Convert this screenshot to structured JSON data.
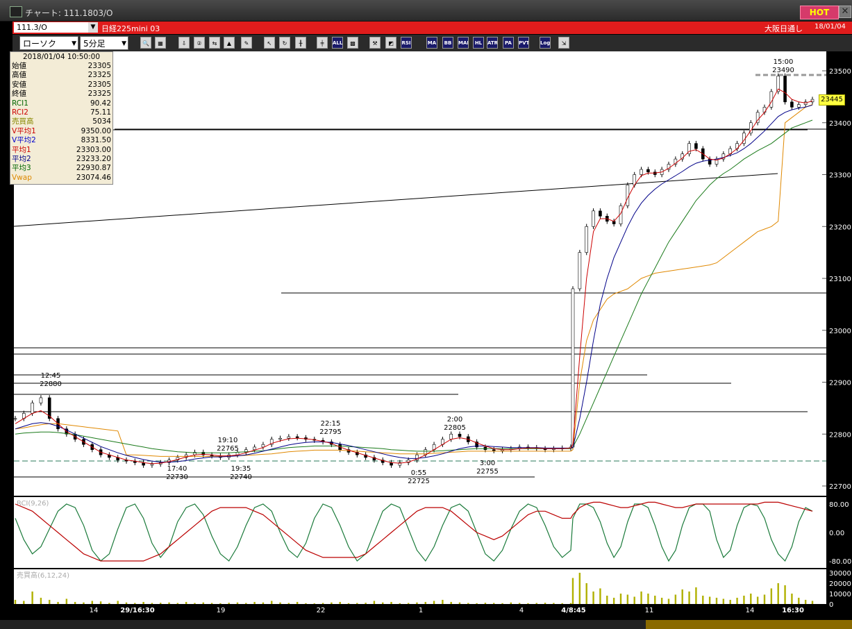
{
  "window": {
    "title": "チャート: 111.1803/O",
    "hot_label": "HOT",
    "close_label": "✕"
  },
  "header": {
    "code": "111.3/O",
    "code_dropdown": "▼",
    "instrument": "日経225mini 03",
    "session": "大阪日通し",
    "date": "18/01/04"
  },
  "toolbar": {
    "chart_type": "ローソク",
    "interval": "5分足",
    "dropdown_arrow": "▼",
    "buttons": [
      {
        "name": "zoom-icon",
        "label": "🔍"
      },
      {
        "name": "grid-icon",
        "label": "▦"
      },
      {
        "name": "draw-down-icon",
        "label": "⇩"
      },
      {
        "name": "count-icon",
        "label": "②"
      },
      {
        "name": "arrows-icon",
        "label": "⇆"
      },
      {
        "name": "fade-icon",
        "label": "▲"
      },
      {
        "name": "pen-icon",
        "label": "✎"
      },
      {
        "name": "cursor-icon",
        "label": "↖"
      },
      {
        "name": "rotate-icon",
        "label": "↻"
      },
      {
        "name": "candle-icon",
        "label": "╫"
      },
      {
        "name": "candle2-icon",
        "label": "╪"
      },
      {
        "name": "all-icon",
        "label": "ALL"
      },
      {
        "name": "pattern-icon",
        "label": "▩"
      },
      {
        "name": "tool-icon",
        "label": "⚒"
      },
      {
        "name": "color-icon",
        "label": "◩"
      },
      {
        "name": "rsi-icon",
        "label": "RSI"
      },
      {
        "name": "ma-icon",
        "label": "MA"
      },
      {
        "name": "bb-icon",
        "label": "BB"
      },
      {
        "name": "mae-icon",
        "label": "MAE"
      },
      {
        "name": "hl-icon",
        "label": "HL"
      },
      {
        "name": "atr-icon",
        "label": "ATR"
      },
      {
        "name": "para-icon",
        "label": "PA"
      },
      {
        "name": "pvt-icon",
        "label": "PVT"
      },
      {
        "name": "log-icon",
        "label": "Log"
      },
      {
        "name": "export-icon",
        "label": "⇲"
      }
    ]
  },
  "info_panel": {
    "datetime": "2018/01/04  10:50:00",
    "rows": [
      {
        "label": "始値",
        "value": "23305",
        "color": "#000000"
      },
      {
        "label": "高値",
        "value": "23325",
        "color": "#000000"
      },
      {
        "label": "安値",
        "value": "23305",
        "color": "#000000"
      },
      {
        "label": "終値",
        "value": "23325",
        "color": "#000000"
      },
      {
        "label": "RCI1",
        "value": "90.42",
        "color": "#006600"
      },
      {
        "label": "RCI2",
        "value": "75.11",
        "color": "#cc0000"
      },
      {
        "label": "売買高",
        "value": "5034",
        "color": "#888800"
      },
      {
        "label": "V平均1",
        "value": "9350.00",
        "color": "#cc0000"
      },
      {
        "label": "V平均2",
        "value": "8331.50",
        "color": "#0000cc"
      },
      {
        "label": "平均1",
        "value": "23303.00",
        "color": "#cc0000"
      },
      {
        "label": "平均2",
        "value": "23233.20",
        "color": "#000088"
      },
      {
        "label": "平均3",
        "value": "22930.87",
        "color": "#006600"
      },
      {
        "label": "Vwap",
        "value": "23074.46",
        "color": "#dd8800"
      }
    ]
  },
  "chart_data": {
    "type": "line",
    "price_axis": [
      23500,
      23400,
      23300,
      23200,
      23100,
      23000,
      22900,
      22800,
      22700
    ],
    "current_price": "23445",
    "annotations": [
      {
        "time": "12:45",
        "price": "22880"
      },
      {
        "time": "17:40",
        "price": "22730"
      },
      {
        "time": "19:10",
        "price": "22765"
      },
      {
        "time": "19:35",
        "price": "22740"
      },
      {
        "time": "22:15",
        "price": "22795"
      },
      {
        "time": "0:55",
        "price": "22725"
      },
      {
        "time": "2:00",
        "price": "22805"
      },
      {
        "time": "3:00",
        "price": "22755"
      },
      {
        "time": "15:00",
        "price": "23490"
      }
    ],
    "x_labels": [
      "14",
      "29/16:30",
      "19",
      "22",
      "1",
      "4",
      "4/8:45",
      "11",
      "14",
      "16:30"
    ],
    "rci_label": "RCI(9,26)",
    "rci_axis": [
      "80.00",
      "0.00",
      "-80.00"
    ],
    "volume_label": "売買高(6,12,24)",
    "volume_axis": [
      "30000",
      "20000",
      "10000",
      "0"
    ],
    "close": [
      22830,
      22840,
      22860,
      22870,
      22830,
      22810,
      22800,
      22790,
      22780,
      22770,
      22760,
      22755,
      22750,
      22748,
      22745,
      22740,
      22742,
      22745,
      22750,
      22755,
      22760,
      22765,
      22760,
      22758,
      22755,
      22760,
      22765,
      22770,
      22775,
      22780,
      22790,
      22792,
      22795,
      22793,
      22790,
      22788,
      22785,
      22780,
      22770,
      22765,
      22760,
      22755,
      22750,
      22745,
      22740,
      22745,
      22750,
      22760,
      22770,
      22780,
      22790,
      22800,
      22795,
      22785,
      22775,
      22770,
      22768,
      22770,
      22772,
      22775,
      22774,
      22772,
      22770,
      22772,
      22773,
      22775,
      23080,
      23150,
      23200,
      23230,
      23220,
      23210,
      23205,
      23240,
      23280,
      23300,
      23310,
      23305,
      23300,
      23310,
      23320,
      23330,
      23340,
      23360,
      23350,
      23330,
      23320,
      23330,
      23340,
      23350,
      23360,
      23380,
      23400,
      23420,
      23430,
      23460,
      23490,
      23440,
      23430,
      23435,
      23440,
      23445
    ],
    "ma1": [
      22820,
      22830,
      22840,
      22845,
      22835,
      22820,
      22805,
      22795,
      22785,
      22775,
      22765,
      22760,
      22755,
      22750,
      22748,
      22745,
      22743,
      22744,
      22747,
      22751,
      22756,
      22760,
      22761,
      22760,
      22758,
      22758,
      22760,
      22764,
      22769,
      22774,
      22782,
      22787,
      22791,
      22792,
      22791,
      22789,
      22786,
      22782,
      22775,
      22769,
      22764,
      22759,
      22754,
      22749,
      22745,
      22744,
      22746,
      22752,
      22760,
      22770,
      22780,
      22790,
      22793,
      22790,
      22783,
      22777,
      22772,
      22770,
      22770,
      22772,
      22773,
      22773,
      22772,
      22772,
      22772,
      22773,
      22780,
      22950,
      23100,
      23190,
      23215,
      23215,
      23210,
      23225,
      23255,
      23280,
      23298,
      23303,
      23303,
      23305,
      23312,
      23322,
      23332,
      23345,
      23348,
      23340,
      23330,
      23328,
      23332,
      23340,
      23350,
      23366,
      23385,
      23405,
      23420,
      23440,
      23465,
      23458,
      23445,
      23440,
      23438,
      23442
    ],
    "ma2": [
      22810,
      22815,
      22820,
      22822,
      22820,
      22815,
      22808,
      22800,
      22792,
      22784,
      22776,
      22770,
      22764,
      22759,
      22755,
      22751,
      22748,
      22746,
      22746,
      22747,
      22749,
      22752,
      22754,
      22756,
      22756,
      22757,
      22758,
      22760,
      22763,
      22767,
      22771,
      22775,
      22779,
      22782,
      22784,
      22785,
      22785,
      22784,
      22781,
      22778,
      22774,
      22770,
      22766,
      22762,
      22758,
      22755,
      22753,
      22753,
      22755,
      22758,
      22762,
      22767,
      22772,
      22775,
      22777,
      22777,
      22776,
      22775,
      22774,
      22774,
      22774,
      22774,
      22773,
      22773,
      22773,
      22773,
      22774,
      22830,
      22900,
      22980,
      23050,
      23100,
      23140,
      23170,
      23200,
      23225,
      23245,
      23260,
      23272,
      23282,
      23290,
      23298,
      23306,
      23315,
      23322,
      23326,
      23328,
      23330,
      23333,
      23337,
      23342,
      23350,
      23360,
      23372,
      23384,
      23398,
      23412,
      23420,
      23425,
      23428,
      23430,
      23434
    ],
    "ma3": [
      22800,
      22802,
      22803,
      22804,
      22804,
      22803,
      22801,
      22799,
      22796,
      22793,
      22790,
      22787,
      22784,
      22781,
      22778,
      22775,
      22772,
      22770,
      22768,
      22766,
      22765,
      22764,
      22764,
      22764,
      22764,
      22764,
      22765,
      22766,
      22767,
      22768,
      22770,
      22772,
      22774,
      22775,
      22776,
      22777,
      22777,
      22777,
      22777,
      22776,
      22775,
      22774,
      22773,
      22772,
      22770,
      22769,
      22768,
      22767,
      22767,
      22767,
      22768,
      22769,
      22770,
      22771,
      22772,
      22772,
      22772,
      22772,
      22772,
      22772,
      22772,
      22772,
      22772,
      22772,
      22772,
      22772,
      22775,
      22800,
      22830,
      22860,
      22890,
      22920,
      22950,
      22980,
      23010,
      23040,
      23070,
      23095,
      23120,
      23145,
      23170,
      23190,
      23210,
      23230,
      23250,
      23265,
      23280,
      23292,
      23302,
      23310,
      23320,
      23330,
      23338,
      23346,
      23353,
      23360,
      23370,
      23380,
      23390,
      23395,
      23400,
      23405
    ],
    "vwap": [
      22810,
      22812,
      22815,
      22818,
      22820,
      22820,
      22818,
      22816,
      22814,
      22812,
      22810,
      22808,
      22806,
      22760,
      22760,
      22759,
      22758,
      22757,
      22757,
      22757,
      22757,
      22757,
      22757,
      22757,
      22757,
      22758,
      22758,
      22759,
      22760,
      22761,
      22762,
      22764,
      22766,
      22767,
      22768,
      22769,
      22769,
      22769,
      22769,
      22768,
      22767,
      22766,
      22765,
      22764,
      22763,
      22762,
      22762,
      22762,
      22762,
      22763,
      22764,
      22765,
      22766,
      22767,
      22767,
      22767,
      22767,
      22767,
      22767,
      22767,
      22767,
      22767,
      22767,
      22767,
      22767,
      22767,
      22770,
      22900,
      22980,
      23020,
      23040,
      23060,
      23070,
      23075,
      23080,
      23090,
      23100,
      23105,
      23110,
      23112,
      23114,
      23116,
      23118,
      23120,
      23122,
      23124,
      23126,
      23130,
      23140,
      23150,
      23160,
      23170,
      23180,
      23190,
      23195,
      23200,
      23210,
      23400,
      23410,
      23420,
      23430,
      23435
    ],
    "rci1": [
      40,
      -20,
      -60,
      -40,
      10,
      60,
      80,
      70,
      20,
      -50,
      -80,
      -60,
      10,
      70,
      80,
      40,
      -30,
      -70,
      -40,
      30,
      70,
      80,
      50,
      -10,
      -60,
      -80,
      -40,
      20,
      70,
      80,
      60,
      0,
      -50,
      -70,
      -30,
      40,
      80,
      70,
      20,
      -40,
      -80,
      -60,
      0,
      60,
      80,
      70,
      10,
      -50,
      -80,
      -40,
      20,
      70,
      80,
      60,
      0,
      -60,
      -80,
      -50,
      10,
      60,
      80,
      70,
      20,
      -40,
      -70,
      -50,
      40,
      80,
      80,
      70,
      30,
      -30,
      -70,
      -40,
      30,
      80,
      80,
      70,
      20,
      -40,
      -80,
      -50,
      20,
      70,
      80,
      80,
      60,
      -20,
      -70,
      -50,
      20,
      70,
      80,
      75,
      40,
      -20,
      -60,
      -80,
      -40,
      30,
      70,
      60
    ],
    "rci2": [
      80,
      70,
      60,
      40,
      20,
      0,
      -20,
      -40,
      -60,
      -70,
      -80,
      -80,
      -80,
      -80,
      -80,
      -80,
      -70,
      -60,
      -40,
      -20,
      0,
      20,
      40,
      60,
      70,
      70,
      70,
      70,
      60,
      50,
      30,
      10,
      -10,
      -30,
      -50,
      -60,
      -70,
      -70,
      -70,
      -70,
      -70,
      -60,
      -40,
      -20,
      0,
      20,
      40,
      60,
      70,
      70,
      70,
      60,
      40,
      20,
      0,
      -10,
      -20,
      -10,
      10,
      30,
      50,
      60,
      60,
      50,
      40,
      40,
      50,
      70,
      80,
      85,
      85,
      80,
      75,
      70,
      70,
      75,
      80,
      85,
      85,
      80,
      75,
      70,
      70,
      75,
      80,
      80,
      80,
      80,
      80,
      80,
      80,
      80,
      80,
      80,
      85,
      85,
      85,
      80,
      75,
      70,
      65,
      60
    ],
    "volume": [
      4000,
      3000,
      12000,
      6000,
      4000,
      2000,
      5000,
      2000,
      1500,
      3000,
      2500,
      1000,
      3000,
      1500,
      1000,
      2000,
      1000,
      1200,
      1500,
      1000,
      2000,
      1000,
      1500,
      1000,
      800,
      1200,
      1500,
      1000,
      2000,
      1500,
      3000,
      1500,
      1000,
      2000,
      800,
      600,
      1000,
      1500,
      2000,
      800,
      1000,
      1200,
      3000,
      1500,
      2000,
      800,
      1000,
      1500,
      2000,
      3000,
      4000,
      2000,
      1500,
      1000,
      800,
      1200,
      1000,
      800,
      1500,
      1000,
      800,
      1000,
      1200,
      1000,
      800,
      900,
      25000,
      30000,
      20000,
      12000,
      15000,
      8000,
      6000,
      10000,
      9000,
      7000,
      12000,
      10000,
      8000,
      6000,
      5000,
      9000,
      14000,
      12000,
      16000,
      8000,
      7000,
      6000,
      5000,
      4000,
      6000,
      8000,
      10000,
      7000,
      9000,
      15000,
      20000,
      18000,
      10000,
      6000,
      4000,
      3000
    ]
  }
}
